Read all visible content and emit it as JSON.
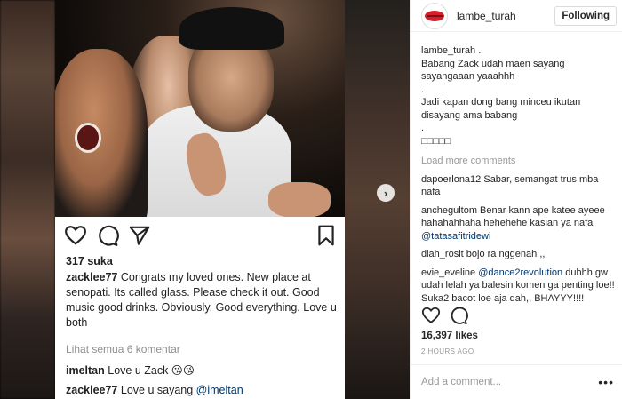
{
  "header": {
    "username": "lambe_turah",
    "follow_label": "Following"
  },
  "caption": {
    "username": "lambe_turah",
    "suffix": " .",
    "lines": [
      "Babang Zack udah maen sayang",
      "sayangaaan yaaahhh",
      ".",
      "Jadi kapan dong bang minceu ikutan",
      "disayang ama babang",
      ".",
      "□□□□□"
    ]
  },
  "load_more": "Load more comments",
  "comments": [
    {
      "user": "dapoerlona12",
      "text": " Sabar, semangat trus mba nafa",
      "mention": "",
      "after": ""
    },
    {
      "user": "anchegultom",
      "text": " Benar kann ape katee ayeee hahahahhaha hehehehe kasian ya nafa ",
      "mention": "@tatasafitridewi",
      "after": ""
    },
    {
      "user": "diah_rosit",
      "text": " bojo ra nggenah ,,",
      "mention": "",
      "after": ""
    },
    {
      "user": "evie_eveline",
      "text": " ",
      "mention": "@dance2revolution",
      "after": " duhhh gw udah lelah ya balesin komen ga penting loe!! Suka2 bacot loe aja dah,, BHAYYY!!!!"
    }
  ],
  "likes": "16,397 likes",
  "time_ago": "2 HOURS AGO",
  "add_comment_placeholder": "Add a comment...",
  "more_label": "•••",
  "media": {
    "inner_likes": "317 suka",
    "inner_caption_user": "zacklee77",
    "inner_caption_text": " Congrats my loved ones. New place at senopati. Its called glass. Please check it out. Good music good drinks. Obviously. Good everything. Love u both",
    "inner_view_all": "Lihat semua 6 komentar",
    "inner_comments": [
      {
        "user": "imeltan",
        "text": " Love u Zack 😘😘",
        "mention": ""
      },
      {
        "user": "zacklee77",
        "text": " Love u sayang ",
        "mention": "@imeltan"
      }
    ],
    "next_arrow": "›"
  },
  "colors": {
    "mention": "#003569",
    "muted": "#999999",
    "border": "#efefef",
    "brand_lips": "#d3202a"
  },
  "icons": [
    "heart-icon",
    "comment-icon",
    "share-icon",
    "bookmark-icon",
    "chevron-right-icon",
    "lips-logo-icon"
  ]
}
